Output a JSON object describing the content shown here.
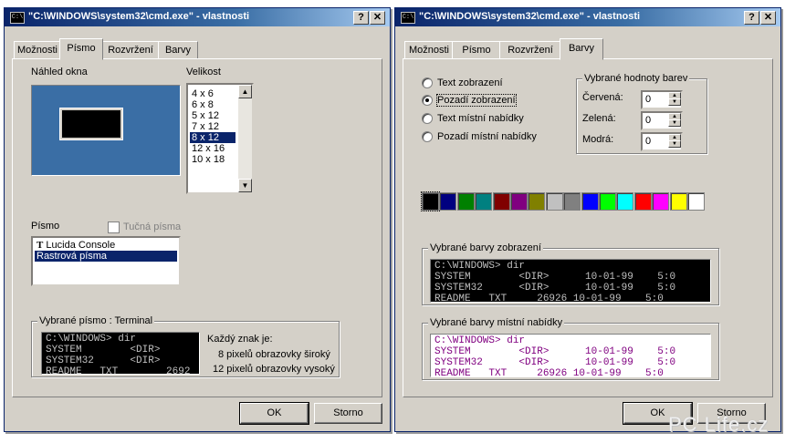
{
  "left": {
    "title": "\"C:\\WINDOWS\\system32\\cmd.exe\" - vlastnosti",
    "icon": "C:\\",
    "tabs": [
      "Možnosti",
      "Písmo",
      "Rozvržení",
      "Barvy"
    ],
    "active_tab": "Písmo",
    "preview_label": "Náhled okna",
    "size_label": "Velikost",
    "sizes": [
      "4 x  6",
      "6 x  8",
      "5 x 12",
      "7 x 12",
      "8 x 12",
      "12 x 16",
      "10 x 18"
    ],
    "selected_size": "8 x 12",
    "font_label": "Písmo",
    "bold_label": "Tučná písma",
    "fonts": [
      "Lucida Console",
      "Rastrová písma"
    ],
    "selected_font": "Rastrová písma",
    "selected_font_group": "Vybrané písmo : Terminal",
    "console_lines": [
      "C:\\WINDOWS> dir",
      "SYSTEM        <DIR>",
      "SYSTEM32      <DIR>",
      "README   TXT        2692"
    ],
    "char_info_title": "Každý znak je:",
    "char_width": "8 pixelů obrazovky široký",
    "char_height": "12 pixelů obrazovky vysoký",
    "ok": "OK",
    "cancel": "Storno"
  },
  "right": {
    "title": "\"C:\\WINDOWS\\system32\\cmd.exe\" - vlastnosti",
    "icon": "C:\\",
    "tabs": [
      "Možnosti",
      "Písmo",
      "Rozvržení",
      "Barvy"
    ],
    "active_tab": "Barvy",
    "radios": [
      "Text zobrazení",
      "Pozadí zobrazení",
      "Text místní nabídky",
      "Pozadí místní nabídky"
    ],
    "selected_radio": "Pozadí zobrazení",
    "rgb_group": "Vybrané hodnoty barev",
    "red_label": "Červená:",
    "green_label": "Zelená:",
    "blue_label": "Modrá:",
    "red": "0",
    "green": "0",
    "blue": "0",
    "palette": [
      "#000000",
      "#000080",
      "#008000",
      "#008080",
      "#800000",
      "#800080",
      "#808000",
      "#c0c0c0",
      "#808080",
      "#0000ff",
      "#00ff00",
      "#00ffff",
      "#ff0000",
      "#ff00ff",
      "#ffff00",
      "#ffffff"
    ],
    "selected_swatch": 0,
    "screen_group": "Vybrané barvy zobrazení",
    "popup_group": "Vybrané barvy místní nabídky",
    "screen_lines": [
      "C:\\WINDOWS> dir",
      "SYSTEM        <DIR>      10-01-99    5:0",
      "SYSTEM32      <DIR>      10-01-99    5:0",
      "README   TXT     26926 10-01-99    5:0"
    ],
    "popup_lines": [
      "C:\\WINDOWS> dir",
      "SYSTEM        <DIR>      10-01-99    5:0",
      "SYSTEM32      <DIR>      10-01-99    5:0",
      "README   TXT     26926 10-01-99    5:0"
    ],
    "ok": "OK",
    "cancel": "Storno"
  },
  "watermark": "PC Life.cz",
  "colors": {
    "title_start": "#0a246a",
    "title_end": "#a6caf0",
    "face": "#d4d0c8",
    "desktop": "#3a6ea5",
    "selection": "#0a246a",
    "console_bg": "#000000",
    "console_text": "#c0c0c0",
    "popup_bg": "#ffffff",
    "popup_text": "#800080"
  }
}
